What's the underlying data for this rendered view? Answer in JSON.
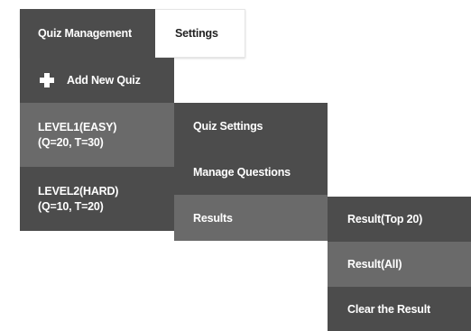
{
  "tabs": {
    "quiz_management": "Quiz Management",
    "settings": "Settings"
  },
  "menu": {
    "add_new_quiz": "Add New Quiz",
    "add_icon": "plus-icon",
    "levels": [
      {
        "line1": "LEVEL1(EASY)",
        "line2": "(Q=20, T=30)"
      },
      {
        "line1": "LEVEL2(HARD)",
        "line2": "(Q=10, T=20)"
      }
    ]
  },
  "submenu": {
    "items": [
      "Quiz Settings",
      "Manage Questions",
      "Results"
    ]
  },
  "results_submenu": {
    "items": [
      "Result(Top 20)",
      "Result(All)",
      "Clear the Result"
    ]
  },
  "colors": {
    "menu_bg": "#4c4c4c",
    "menu_active_bg": "#6a6a6a",
    "text": "#ffffff"
  }
}
